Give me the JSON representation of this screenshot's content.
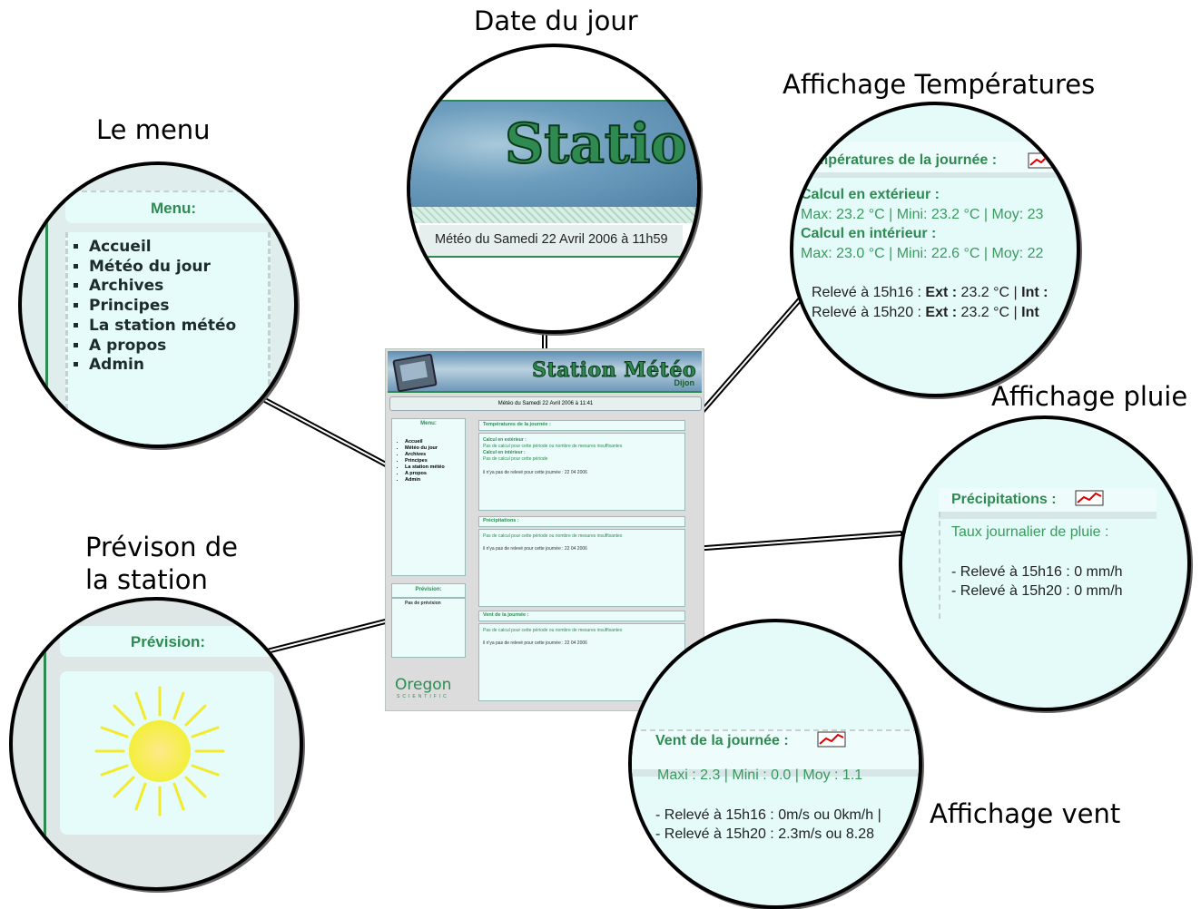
{
  "callouts": {
    "date": "Date du jour",
    "temperatures": "Affichage Températures",
    "menu": "Le menu",
    "pluie": "Affichage pluie",
    "prevision_line1": "Prévison de",
    "prevision_line2": "la station",
    "vent": "Affichage vent"
  },
  "menu_zoom": {
    "title": "Menu:",
    "items": [
      "Accueil",
      "Météo du jour",
      "Archives",
      "Principes",
      "La station météo",
      "A propos",
      "Admin"
    ]
  },
  "date_zoom": {
    "banner_partial": "Statio",
    "date_text": "Météo du Samedi 22 Avril 2006 à 11h59"
  },
  "temp_zoom": {
    "title": "mpératures de la journée :",
    "ext_label": "Calcul en extérieur :",
    "ext_values": "Max: 23.2 °C | Mini: 23.2 °C | Moy: 23",
    "int_label": "Calcul en intérieur :",
    "int_values": "Max: 23.0 °C | Mini: 22.6 °C | Moy: 22",
    "reading1_prefix": "Relevé à 15h16 : ",
    "reading1_ext_label": "Ext :",
    "reading1_ext_val": " 23.2 °C | ",
    "reading1_int_label": "Int :",
    "reading2_prefix": "Relevé à 15h20 : ",
    "reading2_ext_label": "Ext :",
    "reading2_ext_val": " 23.2 °C | ",
    "reading2_int_label": "Int",
    "graph_icon": "chart-icon"
  },
  "rain_zoom": {
    "title": "Précipitations :",
    "rate_label": "Taux journalier de pluie :",
    "reading1": "- Relevé à 15h16 : 0 mm/h",
    "reading2": "- Relevé à 15h20 : 0 mm/h",
    "graph_icon": "chart-icon"
  },
  "prev_zoom": {
    "title": "Prévision:",
    "icon": "sun-icon"
  },
  "wind_zoom": {
    "title": "Vent de la journée :",
    "stats": "Maxi : 2.3 | Mini : 0.0 | Moy : 1.1",
    "reading1": "- Relevé à 15h16 : 0m/s ou 0km/h |",
    "reading2": "- Relevé à 15h20 : 2.3m/s ou 8.28",
    "graph_icon": "chart-icon"
  },
  "screenshot": {
    "banner_title": "Station Météo",
    "banner_sub": "Dijon",
    "date_bar": "Météo du Samedi 22 Avril 2006 à 11:41",
    "menu_title": "Menu:",
    "menu_items": [
      "Accueil",
      "Météo du jour",
      "Archives",
      "Principes",
      "La station météo",
      "A propos",
      "Admin"
    ],
    "prev_title": "Prévision:",
    "prev_text": "Pas de prévision",
    "temp_title": "Températures de la journée :",
    "temp_ext": "Calcul en extérieur :",
    "temp_ext_msg": "Pas de calcul pour cette période ou nombre de mesures insuffisantes",
    "temp_int": "Calcul en intérieur :",
    "temp_int_msg": "Pas de calcul pour cette période",
    "temp_none": "il n'ya pas de relevé pour cette journée : 22 04 2006",
    "rain_title": "Précipitations :",
    "rain_msg": "Pas de calcul pour cette période ou nombre de mesures insuffisantes",
    "rain_none": "il n'ya pas de relevé pour cette journée : 22 04 2006",
    "wind_title": "Vent de la journée :",
    "wind_msg": "Pas de calcul pour cette période ou nombre de mesures insuffisantes",
    "wind_none": "il n'ya pas de relevé pour cette journée : 22 04 2006",
    "brand": "Oregon",
    "brand_sub": "SCIENTIFIC"
  },
  "colors": {
    "accent_green": "#2f8a52",
    "panel_bg": "#e4fbfa"
  }
}
